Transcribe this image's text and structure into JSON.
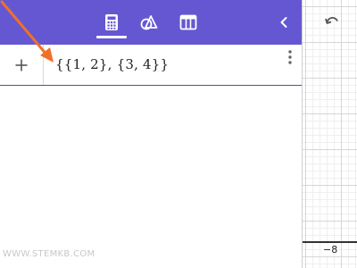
{
  "toolbar": {
    "icons": [
      "calculator-icon",
      "geometry-icon",
      "table-icon"
    ],
    "active_tab": "calculator",
    "collapse_icon": "chevron-left-icon",
    "colors": {
      "bar": "#6557d2",
      "icon": "#ffffff"
    }
  },
  "algebra": {
    "add_icon": "plus-icon",
    "expression": "{{1, 2}, {3, 4}}",
    "menu_icon": "more-vertical-icon"
  },
  "graph": {
    "undo_icon": "undo-icon",
    "tick_label": "−8"
  },
  "watermark": "WWW.STEMKB.COM",
  "annotation": {
    "arrow_color": "#f07028"
  }
}
